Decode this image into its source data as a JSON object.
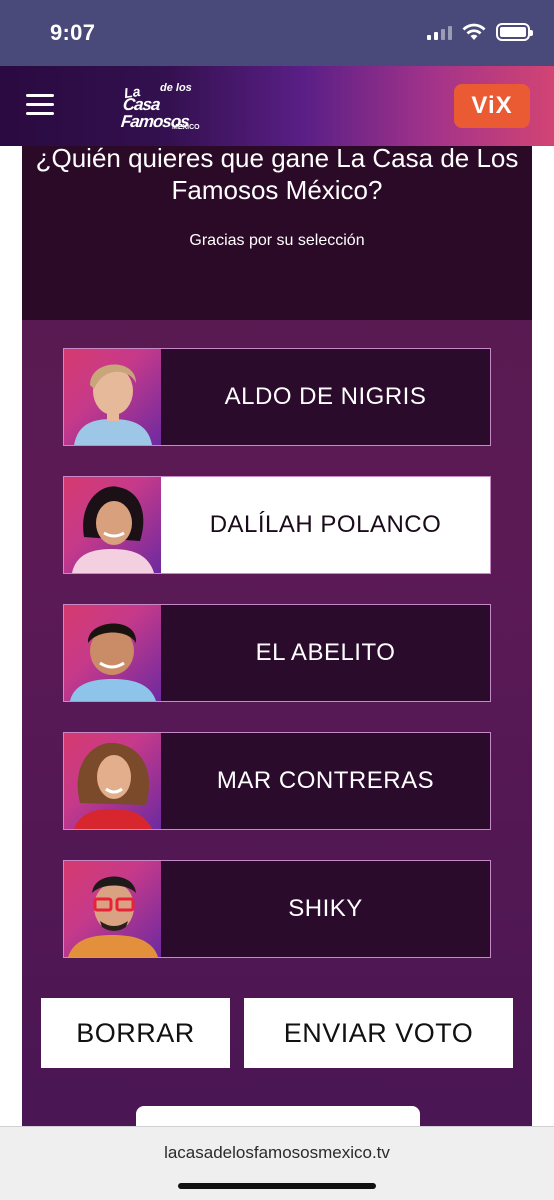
{
  "status_bar": {
    "time": "9:07"
  },
  "header": {
    "logo_text": {
      "la": "La",
      "de_los": "de los",
      "casa_famosos": "Casa Famosos",
      "country": "MÉXICO"
    },
    "vix_label": "ViX"
  },
  "poll": {
    "question": "¿Quién quieres que gane La Casa de Los Famosos México?",
    "confirmation": "Gracias por su selección",
    "options": [
      {
        "label": "ALDO DE NIGRIS",
        "selected": false
      },
      {
        "label": "DALÍLAH POLANCO",
        "selected": true
      },
      {
        "label": "EL ABELITO",
        "selected": false
      },
      {
        "label": "MAR CONTRERAS",
        "selected": false
      },
      {
        "label": "SHIKY",
        "selected": false
      }
    ],
    "clear_label": "BORRAR",
    "send_label": "ENVIAR VOTO"
  },
  "browser": {
    "url": "lacasadelosfamososmexico.tv"
  }
}
